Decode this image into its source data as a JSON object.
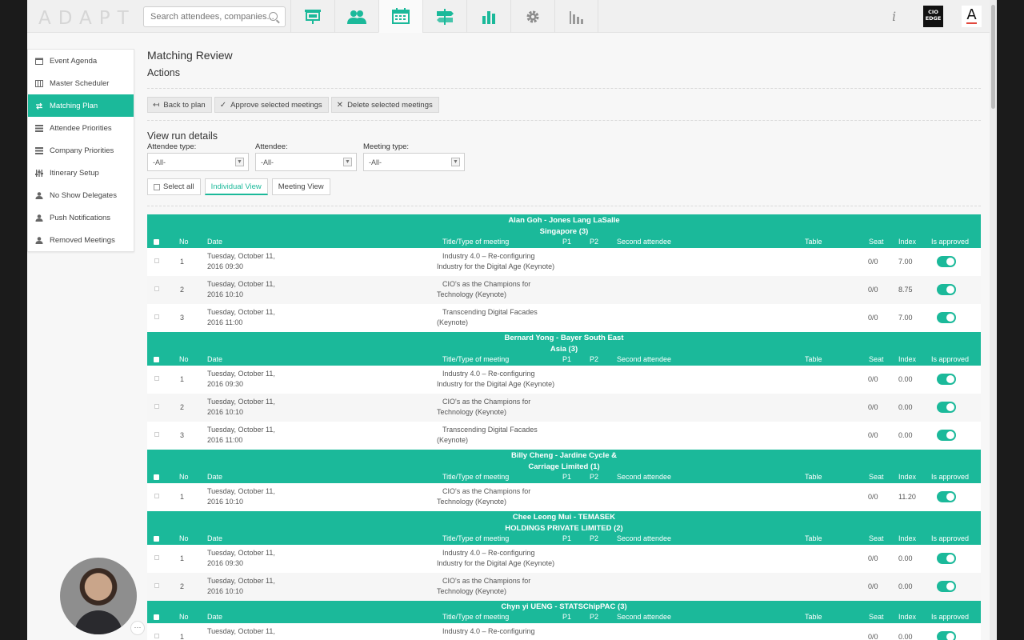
{
  "app": {
    "logo_text": "ADAPT",
    "search_placeholder": "Search attendees, companies...",
    "nav_icons": [
      "presentation-icon",
      "people-icon",
      "calendar-icon",
      "signpost-icon",
      "bar-chart-icon",
      "gear-icon",
      "stats-icon"
    ],
    "info_label": "i",
    "partner_logo": "CIO EDGE",
    "account_logo": "A"
  },
  "sidebar": {
    "items": [
      {
        "label": "Event Agenda",
        "icon": "calendar-icon"
      },
      {
        "label": "Master Scheduler",
        "icon": "columns-icon"
      },
      {
        "label": "Matching Plan",
        "icon": "swap-icon",
        "active": true
      },
      {
        "label": "Attendee Priorities",
        "icon": "list-icon"
      },
      {
        "label": "Company Priorities",
        "icon": "list-icon"
      },
      {
        "label": "Itinerary Setup",
        "icon": "sliders-icon"
      },
      {
        "label": "No Show Delegates",
        "icon": "user-icon"
      },
      {
        "label": "Push Notifications",
        "icon": "user-icon"
      },
      {
        "label": "Removed Meetings",
        "icon": "user-icon"
      }
    ]
  },
  "page": {
    "title": "Matching Review",
    "actions_heading": "Actions",
    "buttons": {
      "back": "Back to plan",
      "approve": "Approve selected meetings",
      "delete": "Delete selected meetings"
    },
    "view_heading": "View run details",
    "filters": {
      "attendee_type_label": "Attendee type:",
      "attendee_type_value": "-All-",
      "attendee_label": "Attendee:",
      "attendee_value": "-All-",
      "meeting_type_label": "Meeting type:",
      "meeting_type_value": "-All-"
    },
    "select_all": "Select all",
    "individual_view": "Individual View",
    "meeting_view": "Meeting View"
  },
  "table": {
    "columns": {
      "no": "No",
      "date": "Date",
      "title": "Title/Type of meeting",
      "p1": "P1",
      "p2": "P2",
      "second": "Second attendee",
      "table": "Table",
      "seat": "Seat",
      "index": "Index",
      "approved": "Is approved"
    },
    "groups": [
      {
        "title": [
          "Alan Goh - Jones Lang LaSalle",
          "Singapore (3)"
        ],
        "rows": [
          {
            "no": "1",
            "date": [
              "Tuesday, October 11,",
              "2016 09:30"
            ],
            "title": [
              "Industry 4.0 – Re-configuring",
              "Industry for the Digital Age (Keynote)"
            ],
            "seat": "0/0",
            "index": "7.00"
          },
          {
            "no": "2",
            "date": [
              "Tuesday, October 11,",
              "2016 10:10"
            ],
            "title": [
              "CIO's as the Champions for",
              "Technology (Keynote)"
            ],
            "seat": "0/0",
            "index": "8.75"
          },
          {
            "no": "3",
            "date": [
              "Tuesday, October 11,",
              "2016 11:00"
            ],
            "title": [
              "Transcending Digital Facades",
              "(Keynote)"
            ],
            "seat": "0/0",
            "index": "7.00"
          }
        ]
      },
      {
        "title": [
          "Bernard Yong - Bayer South East",
          "Asia (3)"
        ],
        "rows": [
          {
            "no": "1",
            "date": [
              "Tuesday, October 11,",
              "2016 09:30"
            ],
            "title": [
              "Industry 4.0 – Re-configuring",
              "Industry for the Digital Age (Keynote)"
            ],
            "seat": "0/0",
            "index": "0.00"
          },
          {
            "no": "2",
            "date": [
              "Tuesday, October 11,",
              "2016 10:10"
            ],
            "title": [
              "CIO's as the Champions for",
              "Technology (Keynote)"
            ],
            "seat": "0/0",
            "index": "0.00"
          },
          {
            "no": "3",
            "date": [
              "Tuesday, October 11,",
              "2016 11:00"
            ],
            "title": [
              "Transcending Digital Facades",
              "(Keynote)"
            ],
            "seat": "0/0",
            "index": "0.00"
          }
        ]
      },
      {
        "title": [
          "Billy Cheng - Jardine Cycle &",
          "Carriage Limited (1)"
        ],
        "rows": [
          {
            "no": "1",
            "date": [
              "Tuesday, October 11,",
              "2016 10:10"
            ],
            "title": [
              "CIO's as the Champions for",
              "Technology (Keynote)"
            ],
            "seat": "0/0",
            "index": "11.20"
          }
        ]
      },
      {
        "title": [
          "Chee Leong Mui - TEMASEK",
          "HOLDINGS PRIVATE LIMITED (2)"
        ],
        "rows": [
          {
            "no": "1",
            "date": [
              "Tuesday, October 11,",
              "2016 09:30"
            ],
            "title": [
              "Industry 4.0 – Re-configuring",
              "Industry for the Digital Age (Keynote)"
            ],
            "seat": "0/0",
            "index": "0.00"
          },
          {
            "no": "2",
            "date": [
              "Tuesday, October 11,",
              "2016 10:10"
            ],
            "title": [
              "CIO's as the Champions for",
              "Technology (Keynote)"
            ],
            "seat": "0/0",
            "index": "0.00"
          }
        ]
      },
      {
        "title": [
          "Chyn yi UENG - STATSChipPAC (3)"
        ],
        "rows": [
          {
            "no": "1",
            "date": [
              "Tuesday, October 11,",
              ""
            ],
            "title": [
              "Industry 4.0 – Re-configuring",
              ""
            ],
            "seat": "0/0",
            "index": "0.00"
          }
        ]
      }
    ]
  },
  "colors": {
    "accent": "#1bb99a",
    "logo_accent": "#e2483d"
  },
  "overlay": {
    "cam_menu": "···"
  }
}
